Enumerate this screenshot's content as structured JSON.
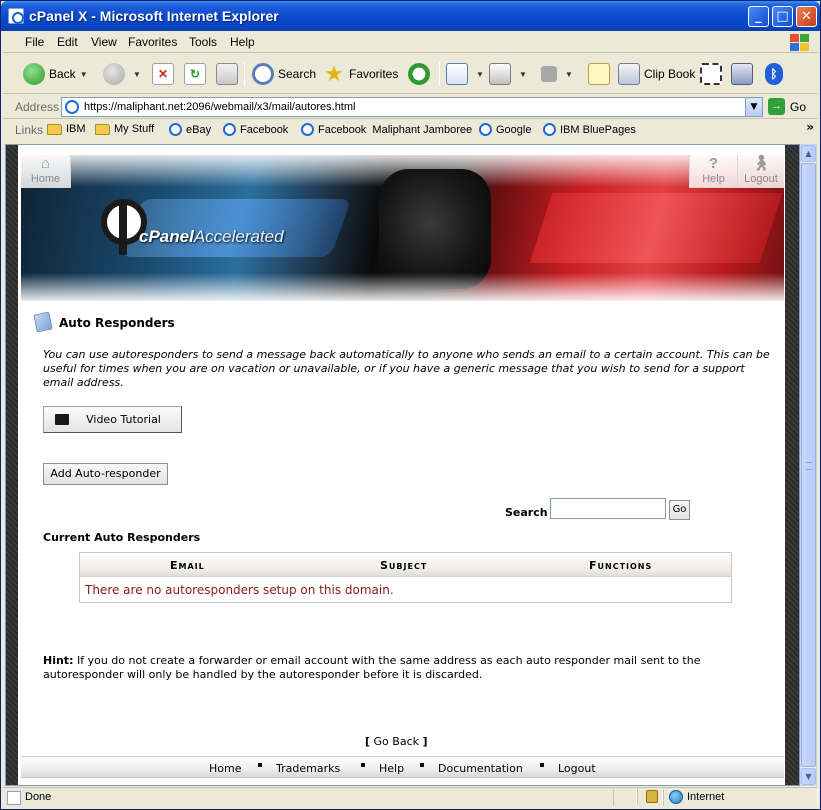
{
  "window": {
    "title": "cPanel X - Microsoft Internet Explorer"
  },
  "menu": [
    "File",
    "Edit",
    "View",
    "Favorites",
    "Tools",
    "Help"
  ],
  "toolbar": {
    "back": "Back",
    "search": "Search",
    "favorites": "Favorites",
    "clip_book": "Clip Book"
  },
  "address": {
    "label": "Address",
    "url": "https://maliphant.net:2096/webmail/x3/mail/autores.html",
    "go": "Go"
  },
  "links": {
    "label": "Links",
    "items": [
      "IBM",
      "My Stuff",
      "eBay",
      "Facebook",
      "Facebook  Maliphant Jamboree",
      "Google",
      "IBM BluePages"
    ]
  },
  "banner": {
    "home": "Home",
    "help": "Help",
    "logout": "Logout",
    "logo_cpanel": "cPanel",
    "logo_accel": "Accelerated"
  },
  "content": {
    "title": "Auto Responders",
    "intro": "You can use autoresponders to send a message back automatically to anyone who sends an email to a certain account. This can be useful for times when you are on vacation or unavailable, or if you have a generic message that you wish to send for a support email address.",
    "video_tutorial": "Video Tutorial",
    "add_button": "Add Auto-responder",
    "search_label": "Search",
    "search_value": "",
    "search_go": "Go",
    "current_title": "Current Auto Responders",
    "columns": [
      "Email",
      "Subject",
      "Functions"
    ],
    "empty_message": "There are no autoresponders setup on this domain.",
    "hint_label": "Hint:",
    "hint_text": " If you do not create a forwarder or email account with the same address as each auto responder mail sent to the autoresponder will only be handled by the autoresponder before it is discarded.",
    "go_back": "Go Back"
  },
  "footer": [
    "Home",
    "Trademarks",
    "Help",
    "Documentation",
    "Logout"
  ],
  "status": {
    "text": "Done",
    "zone": "Internet"
  }
}
